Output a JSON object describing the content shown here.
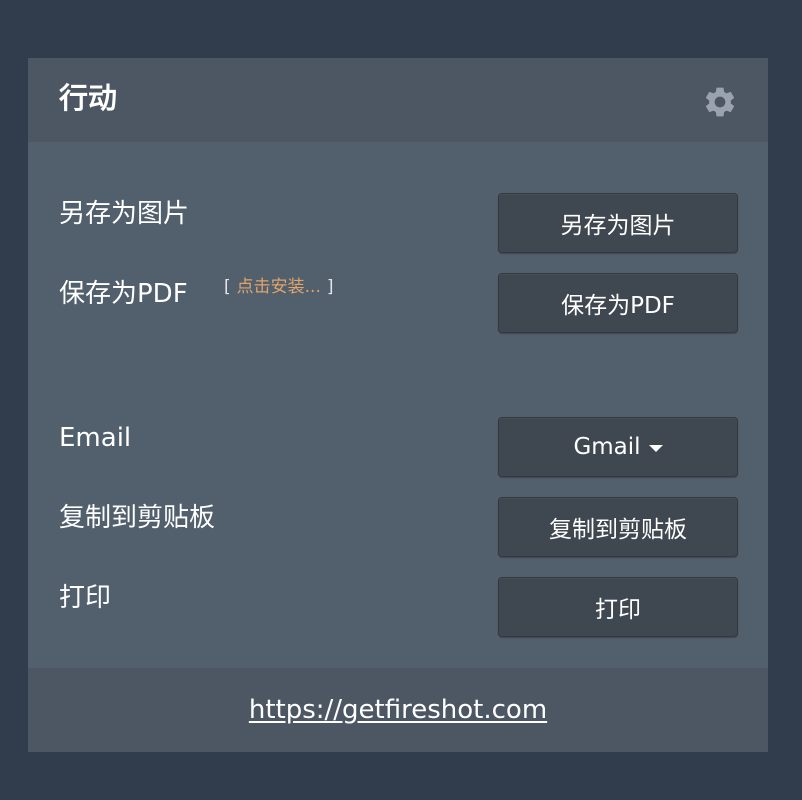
{
  "header": {
    "title": "行动",
    "settings_icon": "gear-icon"
  },
  "rows": {
    "save_image": {
      "label": "另存为图片",
      "button": "另存为图片"
    },
    "save_pdf": {
      "label": "保存为PDF",
      "install_open": "[",
      "install_link": "点击安装...",
      "install_close": "]",
      "button": "保存为PDF"
    },
    "email": {
      "label": "Email",
      "button": "Gmail",
      "dropdown_icon": "caret-down-icon"
    },
    "clipboard": {
      "label": "复制到剪贴板",
      "button": "复制到剪贴板"
    },
    "print": {
      "label": "打印",
      "button": "打印"
    }
  },
  "footer": {
    "link": "https://getfireshot.com"
  },
  "colors": {
    "background": "#313c4c",
    "panel": "#525f6c",
    "header_footer": "#4d5763",
    "button": "#3f4750",
    "install_link": "#e0a46c"
  }
}
